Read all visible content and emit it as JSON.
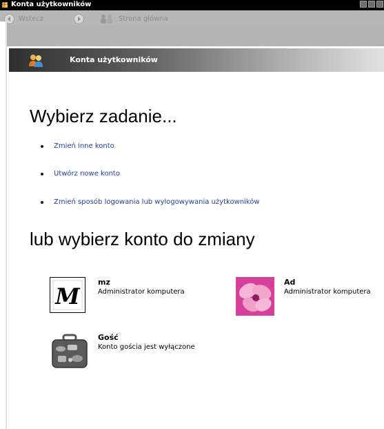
{
  "window": {
    "title": "Konta użytkowników"
  },
  "toolbar": {
    "back_label": "Wstecz",
    "home_label": "Strona główna"
  },
  "header": {
    "title": "Konta użytkowników"
  },
  "main": {
    "task_heading": "Wybierz zadanie...",
    "tasks": [
      {
        "label": "Zmień inne konto"
      },
      {
        "label": "Utwórz nowe konto"
      },
      {
        "label": "Zmień sposób logowania lub wylogowywania użytkowników"
      }
    ],
    "accounts_heading": "lub wybierz konto do zmiany",
    "accounts": [
      {
        "name": "mz",
        "role": "Administrator komputera",
        "picture": "gothic-m-letter"
      },
      {
        "name": "Ad",
        "role": "Administrator komputera",
        "picture": "pink-flower"
      },
      {
        "name": "Gość",
        "role": "Konto gościa jest wyłączone",
        "picture": "suitcase"
      }
    ]
  },
  "colors": {
    "link": "#1f3fa0",
    "titlebar": "#000000",
    "toolbar": "#b4b4b4"
  }
}
